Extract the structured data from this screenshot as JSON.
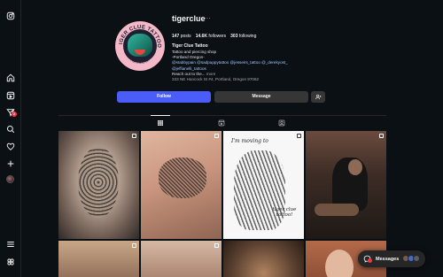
{
  "profile": {
    "username": "tigerclue",
    "more_glyph": "···",
    "full_name": "Tiger Clue Tattoo",
    "stats": {
      "posts_value": "147",
      "posts_label": "posts",
      "followers_value": "14.6K",
      "followers_label": "followers",
      "following_value": "303",
      "following_label": "following"
    },
    "bio": {
      "line1": "Tattoo and piercing shop",
      "line2": "-Portland Oregon-",
      "mentions_line1": "@stabbypain @sadpuppytattoo @jesseirs_tattoo @_derekyost_",
      "mentions_line2": "@jeffianelli_tattoos",
      "reach_out": "Reach out to the...",
      "more": "more",
      "address": "333 NE Hancock St #4, Portland, Oregon 97062"
    },
    "avatar_ring_text": "TIGER CLUE TATTOO",
    "avatar_bottom_text": "PORTLAND OR"
  },
  "actions": {
    "follow_label": "Follow",
    "message_label": "Message",
    "suggest_glyph": "+"
  },
  "tiles": {
    "poster_line1": "I'm moving to",
    "poster_line2": "tiger clue tattoo!"
  },
  "messages_bar": {
    "label": "Messages"
  },
  "colors": {
    "background": "#0b1014",
    "follow_button": "#4a5df9",
    "secondary_button": "#363636",
    "notification_badge": "#ff3040",
    "mention_link": "#a3c4ff"
  },
  "icons": {
    "sidebar": [
      "instagram-logo-icon",
      "home-icon",
      "reels-icon",
      "direct-messages-icon",
      "search-icon",
      "heart-icon",
      "create-icon",
      "profile-avatar",
      "menu-icon",
      "threads-icon"
    ],
    "tabs": [
      "posts-grid-icon",
      "reels-icon",
      "tagged-icon"
    ]
  },
  "sidebar": {
    "notification_count": "2"
  }
}
